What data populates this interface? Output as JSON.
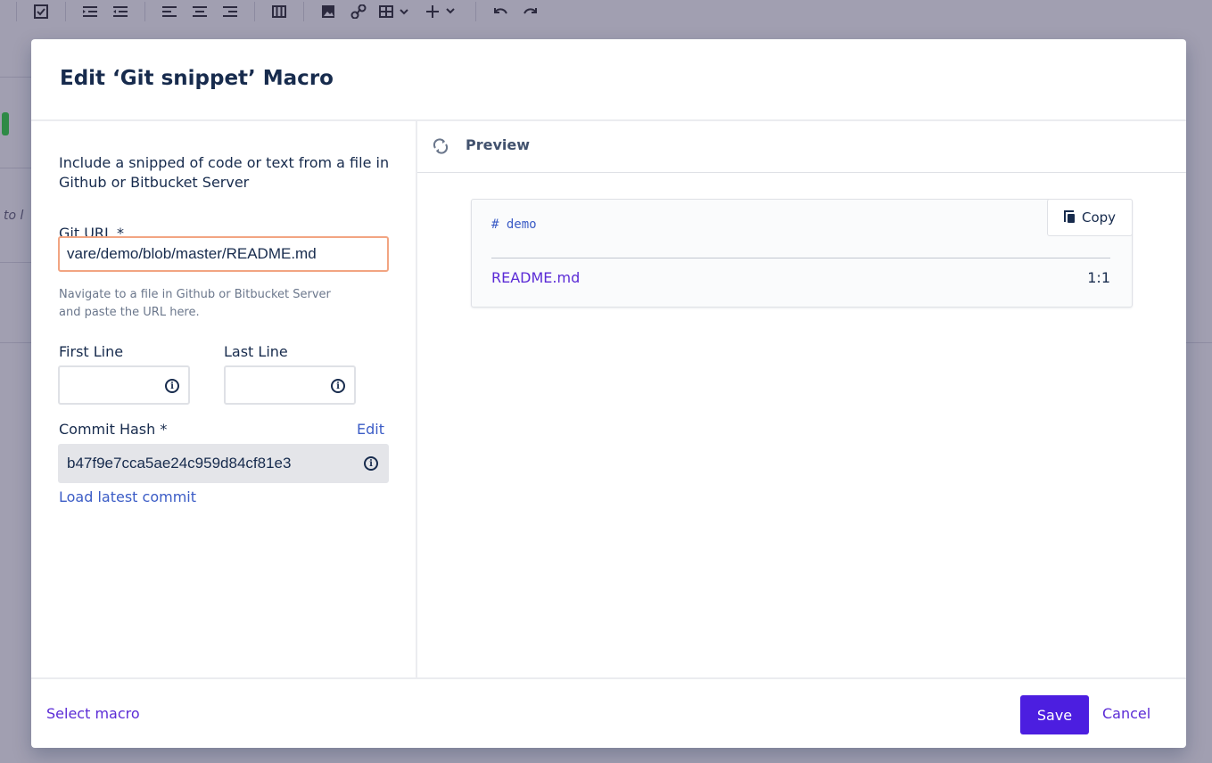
{
  "toolbar": {
    "icons": [
      "checkbox-icon",
      "indent-icon",
      "outdent-icon",
      "align-left-icon",
      "align-center-icon",
      "align-right-icon",
      "layout-icon",
      "image-icon",
      "link-icon",
      "table-icon",
      "insert-icon",
      "undo-icon",
      "redo-icon"
    ]
  },
  "background": {
    "truncated_text": "to l"
  },
  "modal": {
    "title": "Edit ‘Git snippet’ Macro",
    "form": {
      "description": "Include a snipped of code or text from a file in Github or Bitbucket Server",
      "git_url_label": "Git URL *",
      "git_url_value": "vare/demo/blob/master/README.md",
      "git_url_hint": "Navigate to a file in Github or Bitbucket Server and paste the URL here.",
      "first_line_label": "First Line",
      "first_line_value": "",
      "last_line_label": "Last Line",
      "last_line_value": "",
      "commit_hash_label": "Commit Hash *",
      "commit_hash_edit": "Edit",
      "commit_hash_value": "b47f9e7cca5ae24c959d84cf81e3",
      "load_latest": "Load latest commit"
    },
    "preview": {
      "title": "Preview",
      "code_text": "# demo",
      "copy_label": "Copy",
      "file_name": "README.md",
      "line_range": "1:1"
    },
    "footer": {
      "select_macro": "Select macro",
      "save_label": "Save",
      "cancel_label": "Cancel"
    }
  },
  "colors": {
    "primary": "#4c1ee0",
    "link": "#5b2bd6",
    "focus_border": "#f2a582",
    "overlay": "#a19fb1"
  }
}
